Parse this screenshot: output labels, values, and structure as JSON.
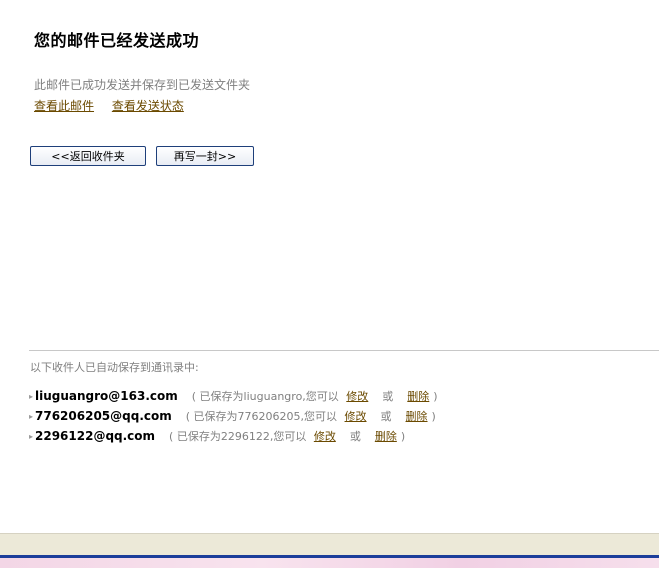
{
  "page": {
    "title": "您的邮件已经发送成功",
    "description": "此邮件已成功发送并保存到已发送文件夹",
    "links": {
      "view_mail": "查看此邮件",
      "view_status": "查看发送状态"
    },
    "buttons": {
      "back": "<<返回收件夹",
      "rewrite": "再写一封>>"
    }
  },
  "contacts_section": {
    "note": "以下收件人已自动保存到通讯录中:",
    "edit_label": "修改",
    "or_label": "或",
    "delete_label": "删除",
    "items": [
      {
        "email": "liuguangro@163.com",
        "saved_prefix": "( 已保存为liuguangro,您可以",
        "suffix": ")"
      },
      {
        "email": "776206205@qq.com",
        "saved_prefix": "( 已保存为776206205,您可以",
        "suffix": ")"
      },
      {
        "email": "2296122@qq.com",
        "saved_prefix": "( 已保存为2296122,您可以",
        "suffix": ")"
      }
    ]
  },
  "colors": {
    "link": "#6b4a00",
    "button_border": "#1e3f7a",
    "muted_text": "#808080",
    "taskbar": "#1c3e9a"
  }
}
